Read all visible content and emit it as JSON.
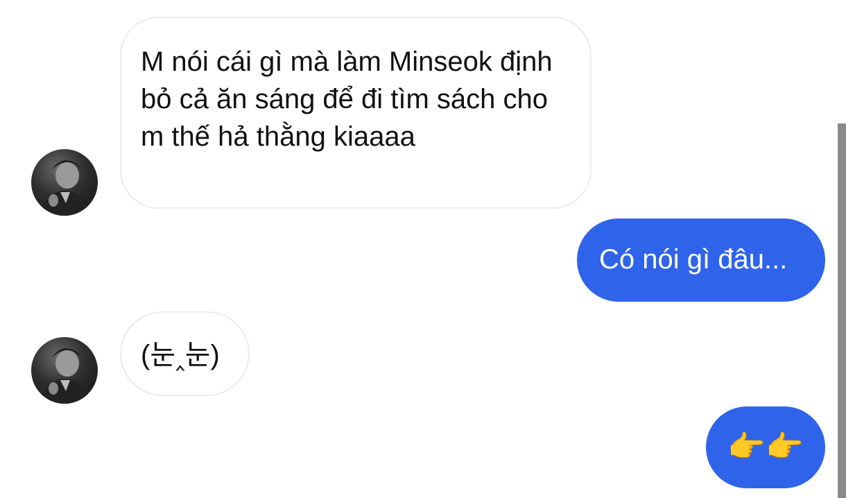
{
  "messages": [
    {
      "direction": "incoming",
      "text": "M nói cái gì mà làm Minseok định bỏ cả ăn sáng để đi tìm sách cho m thế hả thằng kiaaaa",
      "avatar_icon": "contact-avatar"
    },
    {
      "direction": "outgoing",
      "text": "Có nói gì đâu..."
    },
    {
      "direction": "incoming",
      "text": "(눈‸눈)",
      "avatar_icon": "contact-avatar"
    },
    {
      "direction": "outgoing",
      "text": "👉👉",
      "icon": "pointing-hands-emoji"
    }
  ],
  "colors": {
    "outgoing_bubble": "#2f64ea",
    "incoming_border": "#ececec",
    "scrollbar": "#8a8a8a"
  }
}
